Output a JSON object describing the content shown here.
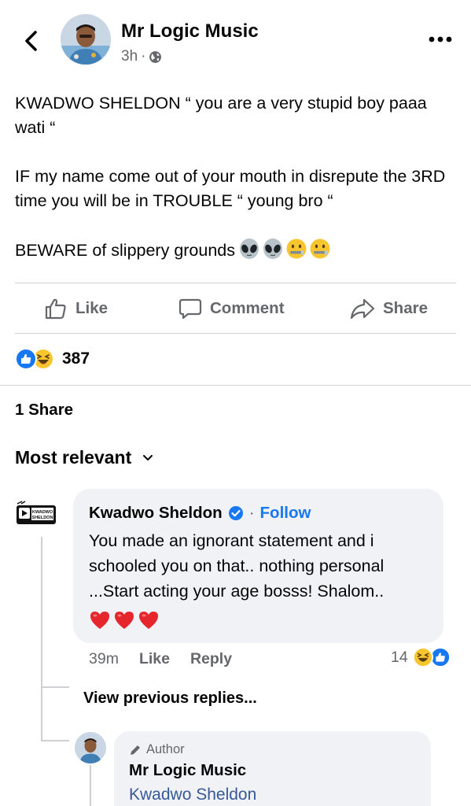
{
  "post": {
    "author": "Mr Logic Music",
    "time": "3h",
    "separator": "·",
    "paragraphs": [
      "KWADWO SHELDON “ you are a very stupid boy paaa wati “",
      "IF my name come out of your mouth in disrepute the 3RD time you will be in TROUBLE “ young bro “",
      "BEWARE of slippery grounds"
    ],
    "emojis": [
      "alien-emoji",
      "alien-emoji",
      "zipper-mouth-emoji",
      "zipper-mouth-emoji"
    ]
  },
  "actions": {
    "like": "Like",
    "comment": "Comment",
    "share": "Share"
  },
  "reactions": {
    "types": [
      "like",
      "haha"
    ],
    "count": "387"
  },
  "shares": "1 Share",
  "sort": {
    "label": "Most relevant"
  },
  "comment": {
    "author": "Kwadwo Sheldon",
    "verified": true,
    "separator": "·",
    "follow": "Follow",
    "text": "You made an ignorant statement and i schooled you on that.. nothing personal ...Start acting your age bosss! Shalom..",
    "hearts": 3,
    "time": "39m",
    "like": "Like",
    "reply": "Reply",
    "reaction_count": "14",
    "reaction_types": [
      "haha",
      "like"
    ],
    "avatar_text": [
      "KWADWO",
      "SHELDON"
    ]
  },
  "view_previous": "View previous replies...",
  "reply": {
    "badge": "Author",
    "author": "Mr Logic Music",
    "mention": "Kwadwo Sheldon"
  },
  "colors": {
    "brand_blue": "#1877f2",
    "muted": "#65676b",
    "bubble": "#f0f2f5",
    "mention": "#385898"
  }
}
